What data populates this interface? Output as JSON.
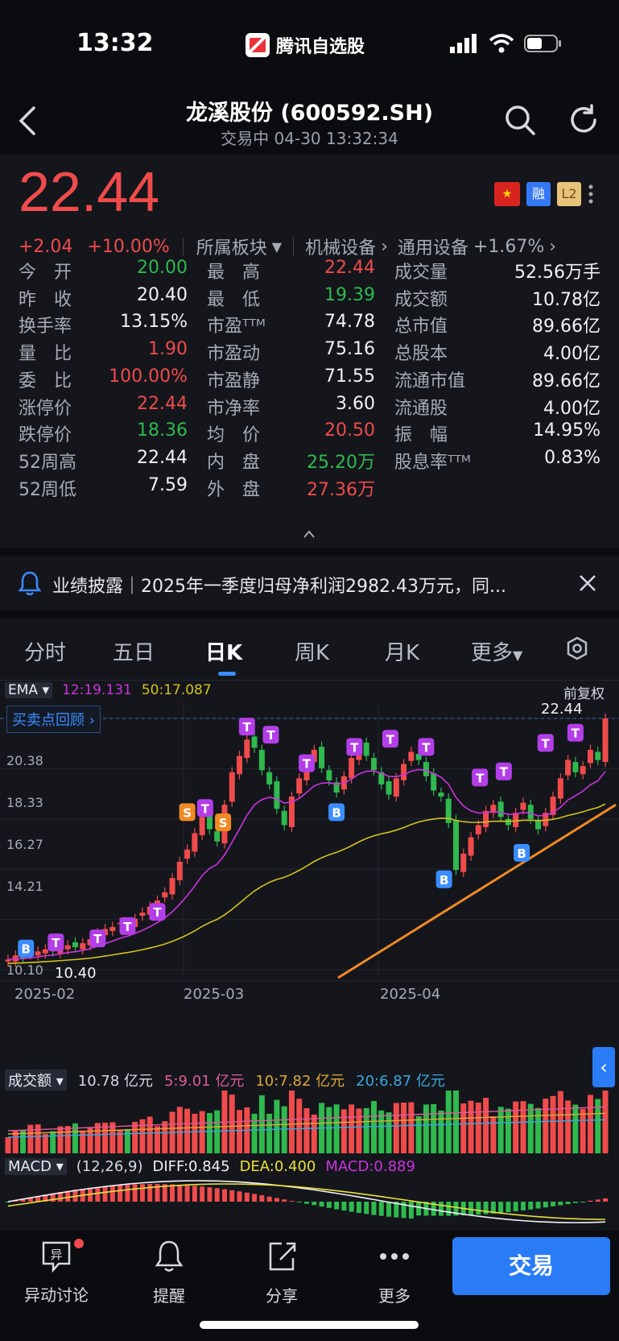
{
  "status": {
    "time": "13:32",
    "app_name": "腾讯自选股"
  },
  "header": {
    "title": "龙溪股份 (600592.SH)",
    "subtitle": "交易中   04-30 13:32:34"
  },
  "quote": {
    "price": "22.44",
    "change": "+2.04",
    "change_pct": "+10.00%",
    "sector_label": "所属板块",
    "sector1": "机械设备",
    "sector2": "通用设备",
    "sector2_pct": "+1.67%",
    "badges": [
      "融",
      "L2"
    ]
  },
  "stats": {
    "col1": [
      {
        "label": "今　开",
        "value": "20.00",
        "color": "#2fb94e"
      },
      {
        "label": "昨　收",
        "value": "20.40",
        "color": "#f2f2f5"
      },
      {
        "label": "换手率",
        "value": "13.15%",
        "color": "#f2f2f5"
      },
      {
        "label": "量　比",
        "value": "1.90",
        "color": "#f04b4b"
      },
      {
        "label": "委　比",
        "value": "100.00%",
        "color": "#f04b4b"
      },
      {
        "label": "涨停价",
        "value": "22.44",
        "color": "#f04b4b"
      },
      {
        "label": "跌停价",
        "value": "18.36",
        "color": "#2fb94e"
      },
      {
        "label": "52周高",
        "value": "22.44",
        "color": "#f2f2f5"
      },
      {
        "label": "52周低",
        "value": "7.59",
        "color": "#f2f2f5"
      }
    ],
    "col2": [
      {
        "label": "最　高",
        "value": "22.44",
        "color": "#f04b4b"
      },
      {
        "label": "最　低",
        "value": "19.39",
        "color": "#2fb94e"
      },
      {
        "label": "市盈ᵀᵀᴹ",
        "value": "74.78",
        "color": "#f2f2f5"
      },
      {
        "label": "市盈动",
        "value": "75.16",
        "color": "#f2f2f5"
      },
      {
        "label": "市盈静",
        "value": "71.55",
        "color": "#f2f2f5"
      },
      {
        "label": "市净率",
        "value": "3.60",
        "color": "#f2f2f5"
      },
      {
        "label": "均　价",
        "value": "20.50",
        "color": "#f04b4b"
      },
      {
        "label": "内　盘",
        "value": "25.20万",
        "color": "#2fb94e"
      },
      {
        "label": "外　盘",
        "value": "27.36万",
        "color": "#f04b4b"
      }
    ],
    "col3": [
      {
        "label": "成交量",
        "value": "52.56万手",
        "color": "#f2f2f5"
      },
      {
        "label": "成交额",
        "value": "10.78亿",
        "color": "#f2f2f5"
      },
      {
        "label": "总市值",
        "value": "89.66亿",
        "color": "#f2f2f5"
      },
      {
        "label": "总股本",
        "value": "4.00亿",
        "color": "#f2f2f5"
      },
      {
        "label": "流通市值",
        "value": "89.66亿",
        "color": "#f2f2f5"
      },
      {
        "label": "流通股",
        "value": "4.00亿",
        "color": "#f2f2f5"
      },
      {
        "label": "振　幅",
        "value": "14.95%",
        "color": "#f2f2f5"
      },
      {
        "label": "股息率ᵀᵀᴹ",
        "value": "0.83%",
        "color": "#f2f2f5"
      }
    ]
  },
  "announcement": {
    "text": "业绩披露｜2025年一季度归母净利润2982.43万元，同..."
  },
  "chart_tabs": [
    "分时",
    "五日",
    "日K",
    "周K",
    "月K",
    "更多"
  ],
  "active_tab": "日K",
  "ema": {
    "label": "EMA",
    "ema12": "12:19.131",
    "ema50": "50:17.087",
    "adjust": "前复权",
    "review": "买卖点回顾",
    "high_label": "22.44",
    "low_label": "10.40",
    "y_ticks": [
      "20.38",
      "18.33",
      "16.27",
      "14.21",
      "10.10"
    ],
    "x_ticks": [
      "2025-02",
      "2025-03",
      "2025-04"
    ]
  },
  "volume": {
    "label": "成交额",
    "value": "10.78 亿元",
    "ma5": "5:9.01 亿元",
    "ma10": "10:7.82 亿元",
    "ma20": "20:6.87 亿元"
  },
  "macd": {
    "label": "MACD",
    "params": "(12,26,9)",
    "diff": "DIFF:0.845",
    "dea": "DEA:0.400",
    "macd": "MACD:0.889"
  },
  "chart_data": {
    "type": "candlestick",
    "dates_axis": [
      "2025-02",
      "2025-03",
      "2025-04"
    ],
    "ylim": [
      10.1,
      22.44
    ],
    "y_ticks": [
      20.38,
      18.33,
      16.27,
      14.21,
      10.1
    ],
    "close": [
      10.6,
      10.8,
      10.7,
      10.9,
      11.0,
      11.1,
      11.0,
      11.2,
      11.3,
      11.2,
      11.4,
      11.6,
      11.9,
      12.1,
      12.2,
      12.4,
      12.3,
      12.6,
      12.9,
      13.2,
      13.5,
      13.9,
      14.6,
      15.4,
      16.0,
      16.8,
      17.6,
      17.0,
      16.4,
      18.2,
      19.8,
      20.6,
      21.4,
      21.0,
      19.9,
      19.2,
      18.0,
      17.2,
      18.6,
      19.5,
      20.4,
      20.9,
      20.0,
      19.4,
      18.8,
      19.6,
      20.5,
      21.1,
      20.6,
      19.9,
      19.2,
      18.7,
      19.5,
      20.2,
      20.8,
      20.4,
      19.6,
      18.9,
      18.6,
      17.3,
      15.0,
      15.8,
      16.6,
      17.2,
      17.9,
      18.2,
      17.6,
      17.2,
      17.8,
      18.3,
      17.5,
      17.0,
      17.8,
      18.6,
      19.5,
      20.4,
      19.8,
      20.1,
      20.9,
      20.4,
      22.44
    ],
    "ema12_last": 19.131,
    "ema50_last": 17.087,
    "volume_amount_last": 10.78,
    "volume_ma": {
      "ma5": 9.01,
      "ma10": 7.82,
      "ma20": 6.87
    },
    "macd_last": {
      "diff": 0.845,
      "dea": 0.4,
      "macd": 0.889
    },
    "colors": {
      "up": "#f04b4b",
      "down": "#2fb94e",
      "ema12": "#cc33dd",
      "ema50": "#d4c21b",
      "trend": "#f08a24"
    }
  },
  "bottom_nav": [
    {
      "label": "异动讨论",
      "icon": "discussion-icon"
    },
    {
      "label": "提醒",
      "icon": "bell-icon"
    },
    {
      "label": "分享",
      "icon": "share-icon"
    },
    {
      "label": "更多",
      "icon": "more-icon"
    }
  ],
  "trade_label": "交易"
}
